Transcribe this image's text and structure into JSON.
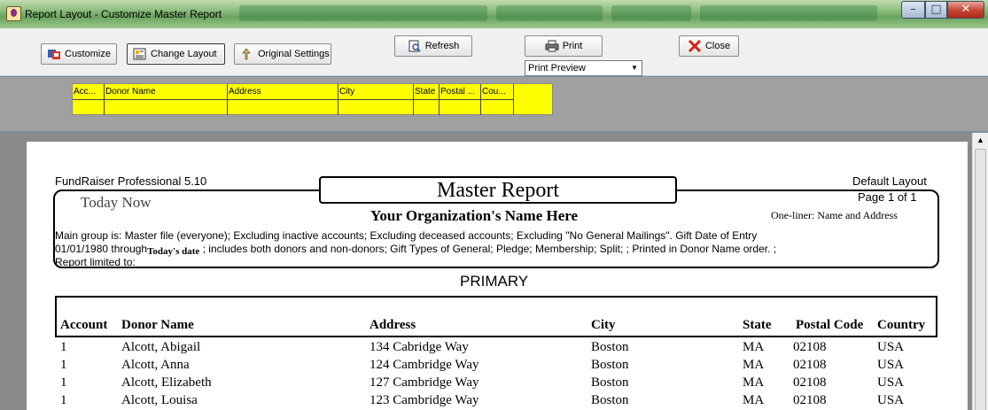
{
  "window": {
    "title": "Report Layout - Customize Master Report",
    "min": "–",
    "max": "□",
    "close": "✕"
  },
  "toolbar": {
    "customize": "Customize",
    "change_layout": "Change Layout",
    "original_settings": "Original Settings",
    "refresh": "Refresh",
    "print": "Print",
    "close": "Close",
    "print_mode": "Print Preview"
  },
  "designer": {
    "columns": [
      "Acc...",
      "Donor Name",
      "Address",
      "City",
      "State",
      "Postal ...",
      "Cou..."
    ]
  },
  "report": {
    "software": "FundRaiser Professional 5.10",
    "layout_name": "Default Layout",
    "title": "Master Report",
    "today": "Today Now",
    "page": "Page 1 of 1",
    "org_name": "Your Organization's Name Here",
    "one_liner": "One-liner:  Name and Address",
    "criteria_line1": "Main group is: Master file (everyone); Excluding inactive accounts; Excluding deceased accounts; Excluding \"No General Mailings\".  Gift Date of Entry",
    "criteria_line2_a": "01/01/1980 through",
    "criteria_line2_b": "Today's date",
    "criteria_line2_c": " ;  includes both donors and non-donors; Gift Types of General; Pledge; Membership; Split; ; Printed in Donor Name order.  ;",
    "criteria_line3": "Report limited to:",
    "section": "PRIMARY",
    "headers": {
      "account": "Account",
      "donor_name": "Donor Name",
      "address": "Address",
      "city": "City",
      "state": "State",
      "postal_code": "Postal Code",
      "country": "Country"
    },
    "rows": [
      {
        "account": "1",
        "name": "Alcott, Abigail",
        "address": "134 Cabridge Way",
        "city": "Boston",
        "state": "MA",
        "postal": "02108",
        "country": "USA"
      },
      {
        "account": "1",
        "name": "Alcott, Anna",
        "address": "124 Cambridge Way",
        "city": "Boston",
        "state": "MA",
        "postal": "02108",
        "country": "USA"
      },
      {
        "account": "1",
        "name": "Alcott, Elizabeth",
        "address": "127 Cambridge Way",
        "city": "Boston",
        "state": "MA",
        "postal": "02108",
        "country": "USA"
      },
      {
        "account": "1",
        "name": "Alcott, Louisa",
        "address": "123 Cambridge Way",
        "city": "Boston",
        "state": "MA",
        "postal": "02108",
        "country": "USA"
      }
    ]
  },
  "colors": {
    "design_grid": "#ffff00",
    "title_bar": "#8fbf80",
    "close_button": "#c4432f"
  }
}
